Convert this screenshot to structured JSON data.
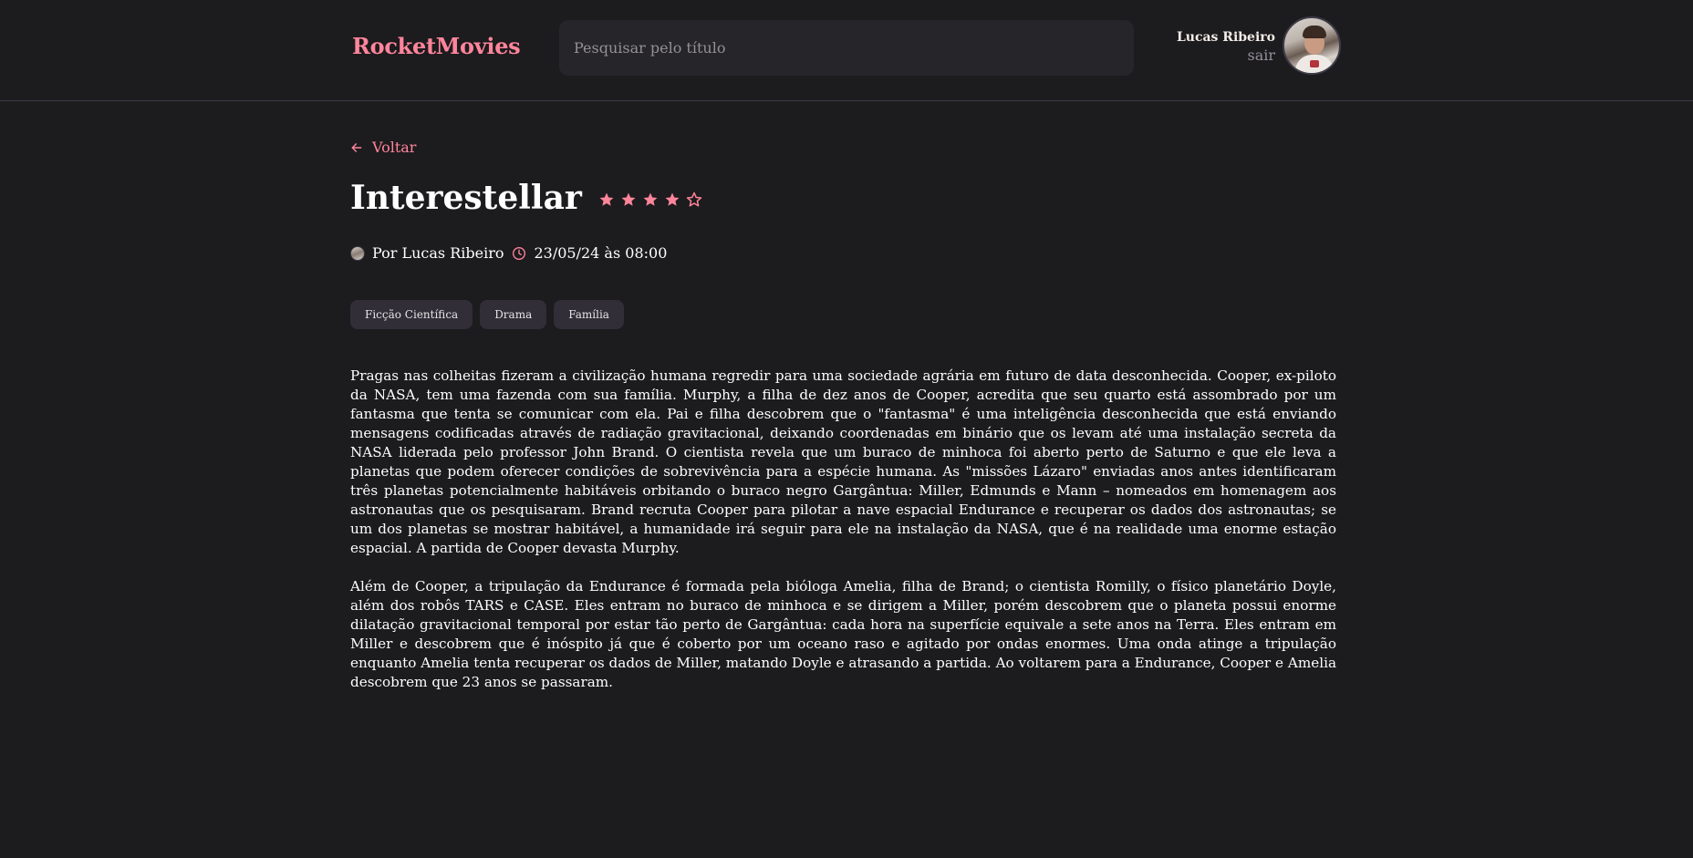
{
  "header": {
    "brand": "RocketMovies",
    "search_placeholder": "Pesquisar pelo título",
    "user_name": "Lucas Ribeiro",
    "logout_label": "sair"
  },
  "back_label": "Voltar",
  "movie": {
    "title": "Interestellar",
    "rating": 4,
    "rating_max": 5,
    "author": "Por Lucas Ribeiro",
    "datetime": "23/05/24 às 08:00",
    "tags": [
      "Ficção Científica",
      "Drama",
      "Família"
    ],
    "description": [
      "Pragas nas colheitas fizeram a civilização humana regredir para uma sociedade agrária em futuro de data desconhecida. Cooper, ex-piloto da NASA, tem uma fazenda com sua família. Murphy, a filha de dez anos de Cooper, acredita que seu quarto está assombrado por um fantasma que tenta se comunicar com ela. Pai e filha descobrem que o \"fantasma\" é uma inteligência desconhecida que está enviando mensagens codificadas através de radiação gravitacional, deixando coordenadas em binário que os levam até uma instalação secreta da NASA liderada pelo professor John Brand. O cientista revela que um buraco de minhoca foi aberto perto de Saturno e que ele leva a planetas que podem oferecer condições de sobrevivência para a espécie humana. As \"missões Lázaro\" enviadas anos antes identificaram três planetas potencialmente habitáveis orbitando o buraco negro Gargântua: Miller, Edmunds e Mann – nomeados em homenagem aos astronautas que os pesquisaram. Brand recruta Cooper para pilotar a nave espacial Endurance e recuperar os dados dos astronautas; se um dos planetas se mostrar habitável, a humanidade irá seguir para ele na instalação da NASA, que é na realidade uma enorme estação espacial. A partida de Cooper devasta Murphy.",
      "Além de Cooper, a tripulação da Endurance é formada pela bióloga Amelia, filha de Brand; o cientista Romilly, o físico planetário Doyle, além dos robôs TARS e CASE. Eles entram no buraco de minhoca e se dirigem a Miller, porém descobrem que o planeta possui enorme dilatação gravitacional temporal por estar tão perto de Gargântua: cada hora na superfície equivale a sete anos na Terra. Eles entram em Miller e descobrem que é inóspito já que é coberto por um oceano raso e agitado por ondas enormes. Uma onda atinge a tripulação enquanto Amelia tenta recuperar os dados de Miller, matando Doyle e atrasando a partida. Ao voltarem para a Endurance, Cooper e Amelia descobrem que 23 anos se passaram."
    ]
  },
  "icons": {
    "back": "arrow-left-icon",
    "star_filled": "star-filled-icon",
    "star_empty": "star-outline-icon",
    "clock": "clock-icon"
  },
  "colors": {
    "background": "#1c1b1e",
    "accent": "#ff859b",
    "input_bg": "#262529",
    "tag_bg": "#312e38",
    "muted": "#948f99"
  }
}
